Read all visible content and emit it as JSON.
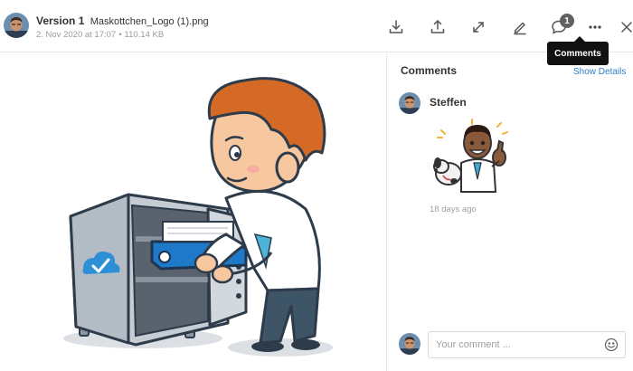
{
  "header": {
    "version_label": "Version 1",
    "file_name": "Maskottchen_Logo (1).png",
    "date": "2. Nov 2020 at 17:07",
    "separator": "•",
    "file_size": "110.14 KB",
    "comment_count": "1",
    "tooltip": "Comments",
    "toolbar_icons": [
      "download-icon",
      "upload-icon",
      "expand-icon",
      "edit-icon",
      "comments-icon",
      "more-icon",
      "close-icon"
    ]
  },
  "comments_panel": {
    "title": "Comments",
    "show_details": "Show Details",
    "comments": [
      {
        "author": "Steffen",
        "time": "18 days ago",
        "content": "sticker-image"
      }
    ],
    "input": {
      "placeholder": "Your comment ...",
      "value": ""
    }
  },
  "colors": {
    "accent_link": "#2b7fc5",
    "tooltip_bg": "#111111",
    "badge_bg": "#616161",
    "cloud_blue": "#2d8fd6"
  }
}
